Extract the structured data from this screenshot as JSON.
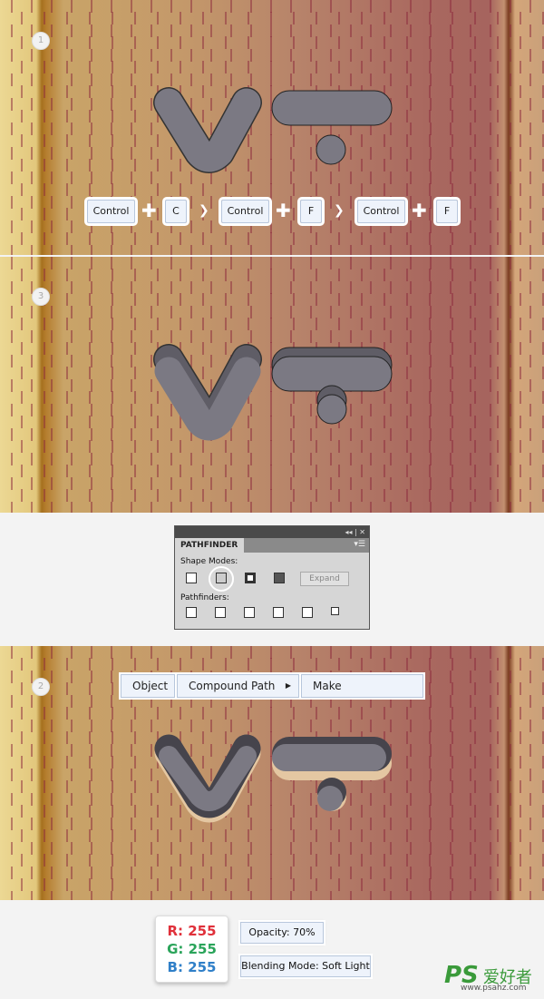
{
  "steps": [
    "1",
    "3",
    "2"
  ],
  "shortcuts": {
    "keys": [
      "Control",
      "C",
      "Control",
      "F",
      "Control",
      "F"
    ],
    "plus": "✚",
    "arrow": "❯"
  },
  "pathfinder": {
    "title": "PATHFINDER",
    "controls": "◂◂ | ✕",
    "menu": "▾☰",
    "shape_modes_label": "Shape Modes:",
    "expand": "Expand",
    "pathfinders_label": "Pathfinders:"
  },
  "menu": {
    "items": [
      "Object",
      "Compound Path",
      "Make"
    ],
    "submenu_arrow": "▶"
  },
  "color": {
    "r": "R: 255",
    "g": "G: 255",
    "b": "B: 255",
    "r_color": "#e0303a",
    "g_color": "#2aa45a",
    "b_color": "#2f7fc8"
  },
  "opacity": "Opacity: 70%",
  "blending": "Blending Mode: Soft Light",
  "watermark": {
    "logo": "PS",
    "cn": "爱好者",
    "url": "www.psahz.com"
  }
}
